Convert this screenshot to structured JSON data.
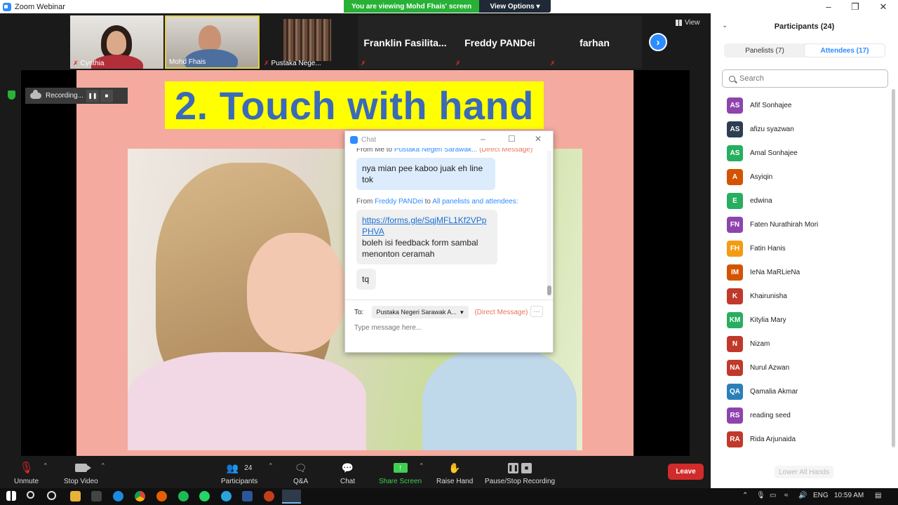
{
  "window": {
    "title": "Zoom Webinar"
  },
  "banner": {
    "viewing": "You are viewing Mohd Fhais' screen",
    "view_options": "View Options"
  },
  "thumbnails": [
    {
      "name": "Cynthia"
    },
    {
      "name": "Mohd Fhais"
    },
    {
      "name": "Pustaka Nege..."
    },
    {
      "name": "Franklin  Fasilita..."
    },
    {
      "name": "Freddy PANDei"
    },
    {
      "name": "farhan"
    }
  ],
  "view_label": "View",
  "recording": {
    "label": "Recording..."
  },
  "slide": {
    "title": "2. Touch with hand"
  },
  "chat": {
    "title": "Chat",
    "msg1_from_prefix": "From Me to",
    "msg1_to": "Pustaka Negeri Sarawak...",
    "msg1_dm": "(Direct Message)",
    "msg1_text": "nya mian pee kaboo juak eh line tok",
    "msg2_from_prefix": "From",
    "msg2_sender": "Freddy PANDei",
    "msg2_to_word": "to",
    "msg2_to": "All panelists and attendees:",
    "msg2_link": "https://forms.gle/SqjMFL1Kf2VPpPHVA",
    "msg2_text": "boleh isi feedback form sambal menonton ceramah",
    "msg3_text": "tq",
    "to_label": "To:",
    "to_value": "Pustaka Negeri Sarawak A...",
    "to_dm": "(Direct Message)",
    "more": "···",
    "input_placeholder": "Type message here..."
  },
  "controls": {
    "unmute": "Unmute",
    "stop_video": "Stop Video",
    "participants": "Participants",
    "participants_count": "24",
    "qa": "Q&A",
    "chat": "Chat",
    "share_screen": "Share Screen",
    "raise_hand": "Raise Hand",
    "pause_recording": "Pause/Stop Recording",
    "leave": "Leave"
  },
  "panel": {
    "title": "Participants (24)",
    "tab_panelists": "Panelists (7)",
    "tab_attendees": "Attendees (17)",
    "search_placeholder": "Search",
    "lower_all_hands": "Lower All Hands",
    "attendees": [
      {
        "initials": "AS",
        "name": "Afif Sonhajee",
        "color": "#8e44ad"
      },
      {
        "initials": "AS",
        "name": "afizu syazwan",
        "color": "#2c3e50"
      },
      {
        "initials": "AS",
        "name": "Amal Sonhajee",
        "color": "#27ae60"
      },
      {
        "initials": "A",
        "name": "Asyiqin",
        "color": "#d35400"
      },
      {
        "initials": "E",
        "name": "edwina",
        "color": "#27ae60"
      },
      {
        "initials": "FN",
        "name": "Faten Nurathirah Mori",
        "color": "#8e44ad"
      },
      {
        "initials": "FH",
        "name": "Fatin Hanis",
        "color": "#f39c12"
      },
      {
        "initials": "IM",
        "name": "IeNa MaRLieNa",
        "color": "#d35400"
      },
      {
        "initials": "K",
        "name": "Khairunisha",
        "color": "#c0392b"
      },
      {
        "initials": "KM",
        "name": "Kitylia Mary",
        "color": "#27ae60"
      },
      {
        "initials": "N",
        "name": "Nizam",
        "color": "#c0392b"
      },
      {
        "initials": "NA",
        "name": "Nurul Azwan",
        "color": "#c0392b"
      },
      {
        "initials": "QA",
        "name": "Qamalia Akmar",
        "color": "#2980b9"
      },
      {
        "initials": "RS",
        "name": "reading seed",
        "color": "#8e44ad"
      },
      {
        "initials": "RA",
        "name": "Rida Arjunaida",
        "color": "#c0392b"
      }
    ]
  },
  "taskbar": {
    "lang": "ENG",
    "time": "10:59 AM"
  }
}
